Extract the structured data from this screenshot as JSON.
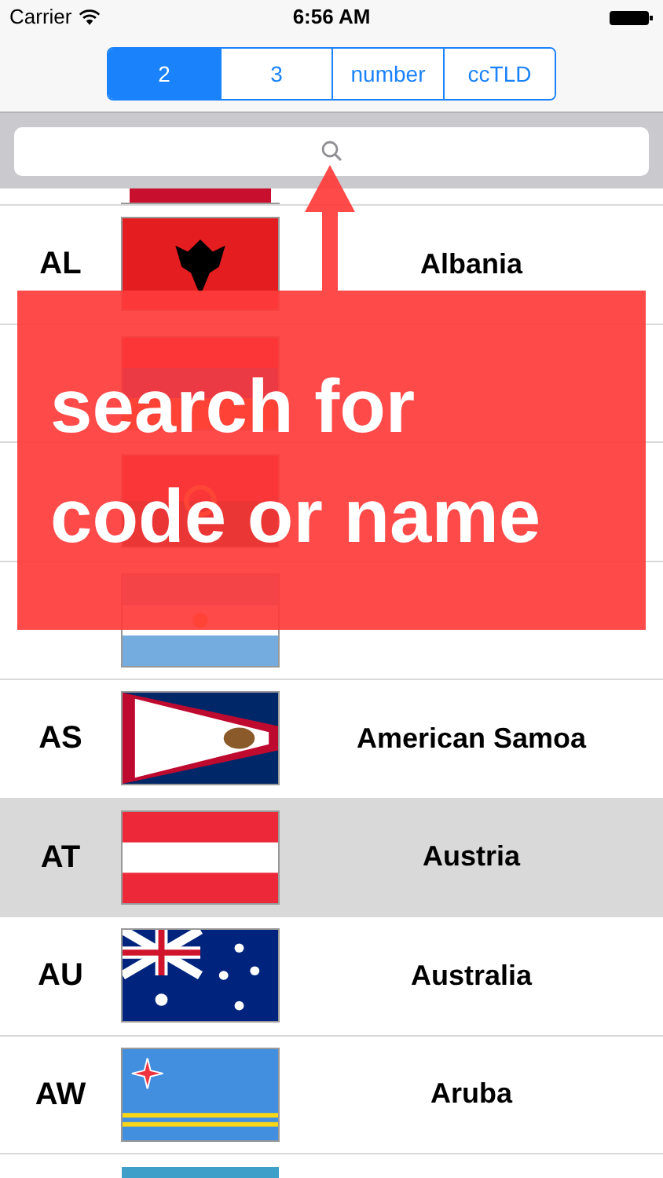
{
  "status_bar": {
    "carrier": "Carrier",
    "time": "6:56 AM"
  },
  "segments": [
    {
      "label": "2",
      "selected": true
    },
    {
      "label": "3",
      "selected": false
    },
    {
      "label": "number",
      "selected": false
    },
    {
      "label": "ccTLD",
      "selected": false
    }
  ],
  "rows": [
    {
      "code": "AL",
      "name": "Albania",
      "selected": false
    },
    {
      "selected": false
    },
    {
      "selected": false
    },
    {
      "selected": false
    },
    {
      "code": "AS",
      "name": "American Samoa",
      "selected": false
    },
    {
      "code": "AT",
      "name": "Austria",
      "selected": true
    },
    {
      "code": "AU",
      "name": "Australia",
      "selected": false
    },
    {
      "code": "AW",
      "name": "Aruba",
      "selected": false
    }
  ],
  "callout": {
    "lines": [
      "search for",
      "code or name"
    ]
  }
}
